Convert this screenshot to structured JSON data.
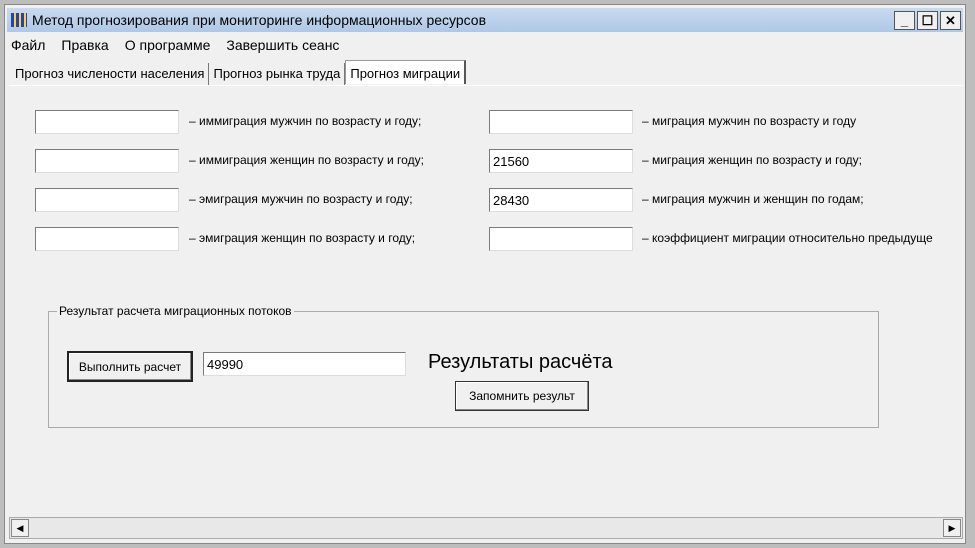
{
  "window": {
    "title": "Метод прогнозирования при мониторинге информационных ресурсов",
    "minimize": "_",
    "maximize": "☐",
    "close": "✕"
  },
  "menu": [
    "Файл",
    "Правка",
    "О программе",
    "Завершить сеанс"
  ],
  "tabs": [
    "Прогноз числености населения",
    "Прогноз рынка труда",
    "Прогноз миграции"
  ],
  "left_fields": [
    {
      "value": "",
      "label": "– иммиграция мужчин по возрасту и году;"
    },
    {
      "value": "",
      "label": "– иммиграция женщин по возрасту и году;"
    },
    {
      "value": "",
      "label": "– эмиграция мужчин по возрасту и году;"
    },
    {
      "value": "",
      "label": "– эмиграция женщин по возрасту и году;"
    }
  ],
  "right_fields": [
    {
      "value": "",
      "label": "– миграция мужчин по возрасту и году"
    },
    {
      "value": "21560",
      "label": "– миграция женщин по возрасту и году;"
    },
    {
      "value": "28430",
      "label": "– миграция мужчин и женщин по годам;"
    },
    {
      "value": "",
      "label": "– коэффициент миграции относительно предыдуще"
    }
  ],
  "group": {
    "legend": "Результат расчета миграционных потоков",
    "run_button": "Выполнить расчет",
    "result_value": "49990",
    "results_heading": "Результаты расчёта",
    "save_button": "Запомнить результ"
  },
  "scroll": {
    "left": "◀",
    "right": "▶"
  }
}
